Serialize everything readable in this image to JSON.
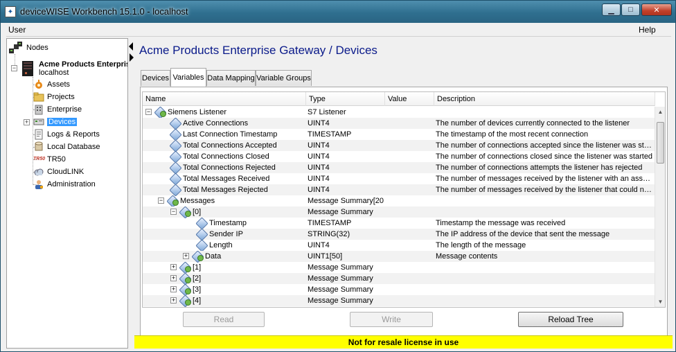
{
  "window": {
    "title": "deviceWISE Workbench 15.1.0  -  localhost",
    "controls": {
      "minimize": "▁",
      "maximize": "□",
      "close": "✕"
    }
  },
  "menu": {
    "user": "User",
    "help": "Help"
  },
  "sidebar": {
    "root": "Nodes",
    "node_name": "Acme Products Enterprise Gateway",
    "node_host": "localhost",
    "items": [
      {
        "label": "Assets",
        "icon": "assets-icon"
      },
      {
        "label": "Projects",
        "icon": "projects-icon"
      },
      {
        "label": "Enterprise",
        "icon": "enterprise-icon"
      },
      {
        "label": "Devices",
        "icon": "devices-icon"
      },
      {
        "label": "Logs & Reports",
        "icon": "logs-icon"
      },
      {
        "label": "Local Database",
        "icon": "database-icon"
      },
      {
        "label": "TR50",
        "icon": "tr50-icon"
      },
      {
        "label": "CloudLINK",
        "icon": "cloudlink-icon"
      },
      {
        "label": "Administration",
        "icon": "administration-icon"
      }
    ],
    "tr50_logo": "TR50"
  },
  "main": {
    "title": "Acme Products Enterprise Gateway / Devices",
    "tabs": [
      "Devices",
      "Variables",
      "Data Mapping",
      "Variable Groups"
    ],
    "columns": [
      "Name",
      "Type",
      "Value",
      "Description"
    ],
    "rows": [
      {
        "name": "Siemens Listener",
        "type": "S7 Listener",
        "value": "",
        "desc": ""
      },
      {
        "name": "Active Connections",
        "type": "UINT4",
        "value": "",
        "desc": "The number of devices currently connected to the listener"
      },
      {
        "name": "Last Connection Timestamp",
        "type": "TIMESTAMP",
        "value": "",
        "desc": "The timestamp of the most recent connection"
      },
      {
        "name": "Total Connections Accepted",
        "type": "UINT4",
        "value": "",
        "desc": "The number of connections accepted since the listener was sta..."
      },
      {
        "name": "Total Connections Closed",
        "type": "UINT4",
        "value": "",
        "desc": "The number of connections closed since the listener was started"
      },
      {
        "name": "Total Connections Rejected",
        "type": "UINT4",
        "value": "",
        "desc": "The number of connections attempts the listener has rejected"
      },
      {
        "name": "Total Messages Received",
        "type": "UINT4",
        "value": "",
        "desc": "The number of messages received by the listener with an asso..."
      },
      {
        "name": "Total Messages Rejected",
        "type": "UINT4",
        "value": "",
        "desc": "The number of messages received by the listener that could no..."
      },
      {
        "name": "Messages",
        "type": "Message Summary[20]",
        "value": "",
        "desc": ""
      },
      {
        "name": "[0]",
        "type": "Message Summary",
        "value": "",
        "desc": ""
      },
      {
        "name": "Timestamp",
        "type": "TIMESTAMP",
        "value": "",
        "desc": "Timestamp the message was received"
      },
      {
        "name": "Sender IP",
        "type": "STRING(32)",
        "value": "",
        "desc": "The IP address of the device that sent the message"
      },
      {
        "name": "Length",
        "type": "UINT4",
        "value": "",
        "desc": "The length of the message"
      },
      {
        "name": "Data",
        "type": "UINT1[50]",
        "value": "",
        "desc": "Message contents"
      },
      {
        "name": "[1]",
        "type": "Message Summary",
        "value": "",
        "desc": ""
      },
      {
        "name": "[2]",
        "type": "Message Summary",
        "value": "",
        "desc": ""
      },
      {
        "name": "[3]",
        "type": "Message Summary",
        "value": "",
        "desc": ""
      },
      {
        "name": "[4]",
        "type": "Message Summary",
        "value": "",
        "desc": ""
      }
    ],
    "buttons": {
      "read": "Read",
      "write": "Write",
      "reload": "Reload Tree"
    }
  },
  "license": "Not for resale license in use",
  "colors": {
    "license_bg": "#ffff00",
    "title_color": "#0a1a8a",
    "selection": "#3399ff"
  }
}
